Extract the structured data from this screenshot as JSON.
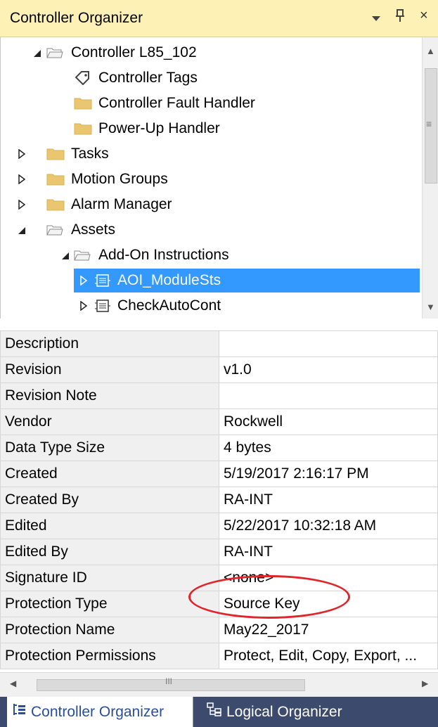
{
  "panel": {
    "title": "Controller Organizer",
    "dropdown_glyph": "▾",
    "pin_glyph": "ᅟ⊥",
    "close_glyph": "×"
  },
  "tree": {
    "nodes": [
      {
        "label": "Controller L85_102",
        "expander": "◢",
        "icon": "folder-open-icon"
      },
      {
        "label": "Controller Tags",
        "expander": "",
        "icon": "tag-icon"
      },
      {
        "label": "Controller Fault Handler",
        "expander": "",
        "icon": "folder-icon"
      },
      {
        "label": "Power-Up Handler",
        "expander": "",
        "icon": "folder-icon"
      },
      {
        "label": "Tasks",
        "expander": "▷",
        "icon": "folder-icon"
      },
      {
        "label": "Motion Groups",
        "expander": "▷",
        "icon": "folder-icon"
      },
      {
        "label": "Alarm Manager",
        "expander": "▷",
        "icon": "folder-icon"
      },
      {
        "label": "Assets",
        "expander": "◢",
        "icon": "folder-open-icon"
      },
      {
        "label": "Add-On Instructions",
        "expander": "◢",
        "icon": "folder-open-icon"
      },
      {
        "label": "AOI_ModuleSts",
        "expander": "▷",
        "icon": "aoi-icon",
        "selected": true
      },
      {
        "label": "CheckAutoCont",
        "expander": "▷",
        "icon": "aoi-icon"
      }
    ]
  },
  "properties": {
    "rows": [
      {
        "key": "Description",
        "value": ""
      },
      {
        "key": "Revision",
        "value": "v1.0"
      },
      {
        "key": "Revision Note",
        "value": ""
      },
      {
        "key": "Vendor",
        "value": "Rockwell"
      },
      {
        "key": "Data Type Size",
        "value": "4 bytes"
      },
      {
        "key": "Created",
        "value": "5/19/2017  2:16:17 PM"
      },
      {
        "key": "Created By",
        "value": "RA-INT"
      },
      {
        "key": "Edited",
        "value": "5/22/2017  10:32:18 AM"
      },
      {
        "key": "Edited By",
        "value": "RA-INT"
      },
      {
        "key": "Signature ID",
        "value": "<none>"
      },
      {
        "key": "Protection Type",
        "value": "Source Key"
      },
      {
        "key": "Protection Name",
        "value": "May22_2017"
      },
      {
        "key": "Protection Permissions",
        "value": "Protect, Edit, Copy, Export, ..."
      }
    ]
  },
  "scroll": {
    "grip_v": "≡",
    "grip_h": "III",
    "up": "▲",
    "down": "▼",
    "left": "◀",
    "right": "▶"
  },
  "tabs": [
    {
      "label": "Controller Organizer",
      "icon": "organizer-icon",
      "active": true
    },
    {
      "label": "Logical Organizer",
      "icon": "logical-organizer-icon",
      "active": false
    }
  ],
  "colors": {
    "title_bg": "#fdf1b6",
    "selection": "#3399ff",
    "tab_bar": "#3c4a6e",
    "annotation": "#e0252b"
  }
}
